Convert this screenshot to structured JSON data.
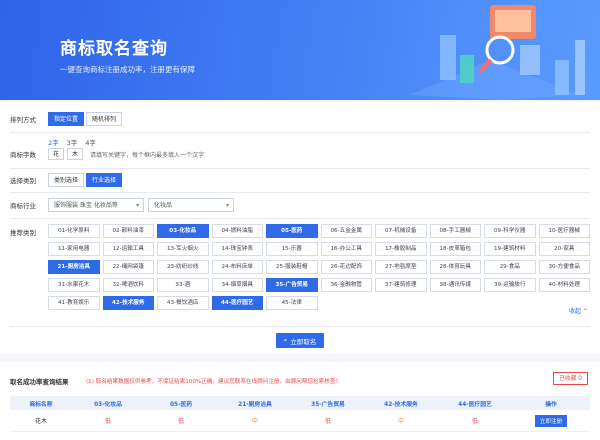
{
  "banner": {
    "title": "商标取名查询",
    "subtitle": "一键查询商标注册成功率，注册更有保障"
  },
  "form": {
    "sort": {
      "label": "排列方式",
      "options": [
        "指定位置",
        "随机排列"
      ],
      "active": 0
    },
    "word_count": {
      "label": "商标字数",
      "options": [
        "2字",
        "3字",
        "4字"
      ],
      "active": 0,
      "boxes": [
        "花",
        "木"
      ],
      "hint": "请填写关键字，每个框内最多填入一个汉字"
    },
    "category_select": {
      "label": "选择类别",
      "options": [
        "类别选择",
        "行业选择"
      ],
      "active": 1
    },
    "industry": {
      "label": "商标行业",
      "select1": "服饰服装 珠宝 化妆品等",
      "select2": "化妆品"
    },
    "recommended": {
      "label": "推荐类别",
      "classes": [
        {
          "label": "01-化学原料",
          "selected": false
        },
        {
          "label": "02-颜料油漆",
          "selected": false
        },
        {
          "label": "03-化妆品",
          "selected": true
        },
        {
          "label": "04-燃料油脂",
          "selected": false
        },
        {
          "label": "05-医药",
          "selected": true
        },
        {
          "label": "06-五金金属",
          "selected": false
        },
        {
          "label": "07-机械设备",
          "selected": false
        },
        {
          "label": "08-手工器械",
          "selected": false
        },
        {
          "label": "09-科学仪器",
          "selected": false
        },
        {
          "label": "10-医疗器械",
          "selected": false
        },
        {
          "label": "11-家用电器",
          "selected": false
        },
        {
          "label": "12-运输工具",
          "selected": false
        },
        {
          "label": "13-军火烟火",
          "selected": false
        },
        {
          "label": "14-珠宝钟表",
          "selected": false
        },
        {
          "label": "15-乐器",
          "selected": false
        },
        {
          "label": "16-办公工具",
          "selected": false
        },
        {
          "label": "17-橡胶制品",
          "selected": false
        },
        {
          "label": "18-皮革箱包",
          "selected": false
        },
        {
          "label": "19-建筑材料",
          "selected": false
        },
        {
          "label": "20-家具",
          "selected": false
        },
        {
          "label": "21-厨房洁具",
          "selected": true
        },
        {
          "label": "22-绳网袋篷",
          "selected": false
        },
        {
          "label": "23-纺织纱线",
          "selected": false
        },
        {
          "label": "24-布料床单",
          "selected": false
        },
        {
          "label": "25-服装鞋帽",
          "selected": false
        },
        {
          "label": "26-花边配饰",
          "selected": false
        },
        {
          "label": "27-地毯席垫",
          "selected": false
        },
        {
          "label": "28-体育玩具",
          "selected": false
        },
        {
          "label": "29-食品",
          "selected": false
        },
        {
          "label": "30-方便食品",
          "selected": false
        },
        {
          "label": "31-水果花木",
          "selected": false
        },
        {
          "label": "32-啤酒饮料",
          "selected": false
        },
        {
          "label": "33-酒",
          "selected": false
        },
        {
          "label": "34-烟草烟具",
          "selected": false
        },
        {
          "label": "35-广告贸易",
          "selected": true
        },
        {
          "label": "36-金融物管",
          "selected": false
        },
        {
          "label": "37-建筑修理",
          "selected": false
        },
        {
          "label": "38-通讯传媒",
          "selected": false
        },
        {
          "label": "39-运输旅行",
          "selected": false
        },
        {
          "label": "40-材料处理",
          "selected": false
        },
        {
          "label": "41-教育娱乐",
          "selected": false
        },
        {
          "label": "42-技术服务",
          "selected": true
        },
        {
          "label": "43-餐饮酒店",
          "selected": false
        },
        {
          "label": "44-医疗园艺",
          "selected": true
        },
        {
          "label": "45-法律",
          "selected": false
        }
      ],
      "collapse": "收起"
    },
    "submit": "立即取名"
  },
  "results": {
    "title": "取名成功率查询结果",
    "note": "(1) 取名结果数据仅供参考，不保证结果100%正确，建议您联系在线顾问注册，由顾问帮您检索核查！",
    "chosen": "已收藏 0",
    "headers": [
      "商标名称",
      "03-化妆品",
      "05-医药",
      "21-厨房洁具",
      "35-广告贸易",
      "42-技术服务",
      "44-医疗园艺",
      "操作"
    ],
    "rows": [
      {
        "name": "花木",
        "levels": [
          "低",
          "低",
          "中",
          "低",
          "中",
          "低"
        ],
        "action": "立即注册"
      }
    ]
  },
  "colors": {
    "primary": "#2f6be9",
    "low": "#e84a4a",
    "mid": "#f08a2c"
  }
}
